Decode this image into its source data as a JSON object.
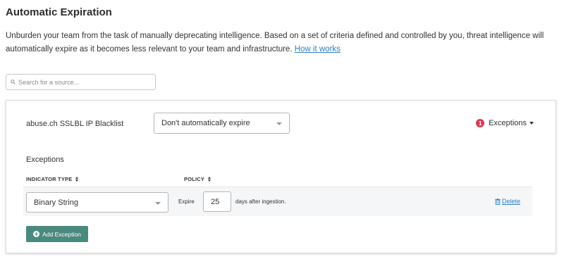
{
  "page": {
    "title": "Automatic Expiration",
    "description": "Unburden your team from the task of manually deprecating intelligence. Based on a set of criteria defined and controlled by you, threat intelligence will automatically expire as it becomes less relevant to your team and infrastructure.",
    "how_it_works_link": "How it works"
  },
  "search": {
    "placeholder": "Search for a source...",
    "value": ""
  },
  "source": {
    "name": "abuse.ch SSLBL IP Blacklist",
    "policy_selected": "Don't automatically expire",
    "exceptions_badge": "1",
    "exceptions_toggle_label": "Exceptions"
  },
  "exceptions": {
    "heading": "Exceptions",
    "columns": {
      "indicator_type": "INDICATOR TYPE",
      "policy": "POLICY"
    },
    "rows": [
      {
        "indicator_type": "Binary String",
        "expire_label": "Expire",
        "days": "25",
        "after_label": "days after ingestion.",
        "delete_label": "Delete"
      }
    ],
    "add_button": "Add Exception"
  },
  "colors": {
    "link": "#2f7fc1",
    "badge": "#d93a57",
    "add_button": "#4a8a7e",
    "row_background": "#f4f6f8"
  },
  "icons": {
    "search": "search-icon",
    "badge": "count-badge",
    "dropdown": "chevron-down-icon",
    "sort": "sort-icon",
    "delete": "trash-icon",
    "add": "plus-circle-icon"
  }
}
